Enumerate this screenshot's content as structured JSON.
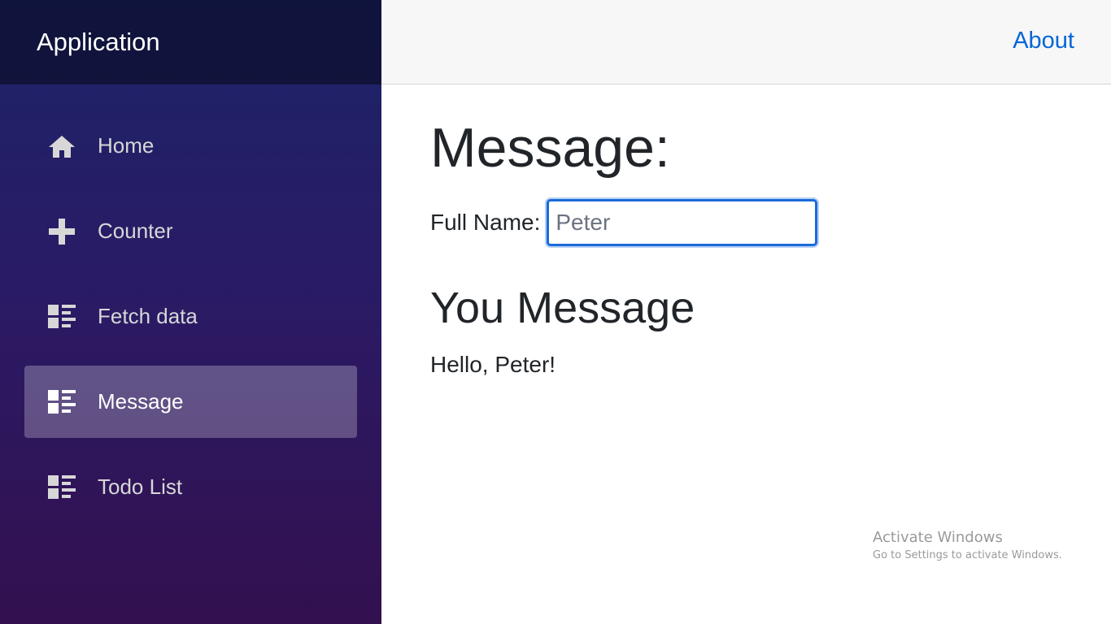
{
  "sidebar": {
    "brand": "Application",
    "items": [
      {
        "label": "Home",
        "icon": "home-icon"
      },
      {
        "label": "Counter",
        "icon": "plus-icon"
      },
      {
        "label": "Fetch data",
        "icon": "list-rich-icon"
      },
      {
        "label": "Message",
        "icon": "list-rich-icon",
        "active": true
      },
      {
        "label": "Todo List",
        "icon": "list-rich-icon"
      }
    ]
  },
  "top_row": {
    "about_label": "About"
  },
  "main": {
    "title": "Message:",
    "full_name_label": "Full Name:",
    "full_name_value": "Peter",
    "section_title": "You Message",
    "greeting": "Hello, Peter!"
  },
  "watermark": {
    "title": "Activate Windows",
    "subtitle": "Go to Settings to activate Windows."
  },
  "colors": {
    "link": "#0366d6",
    "sidebar_top": "#1b2468",
    "sidebar_bottom": "#33104f",
    "input_focus_border": "#1b6ad8"
  }
}
